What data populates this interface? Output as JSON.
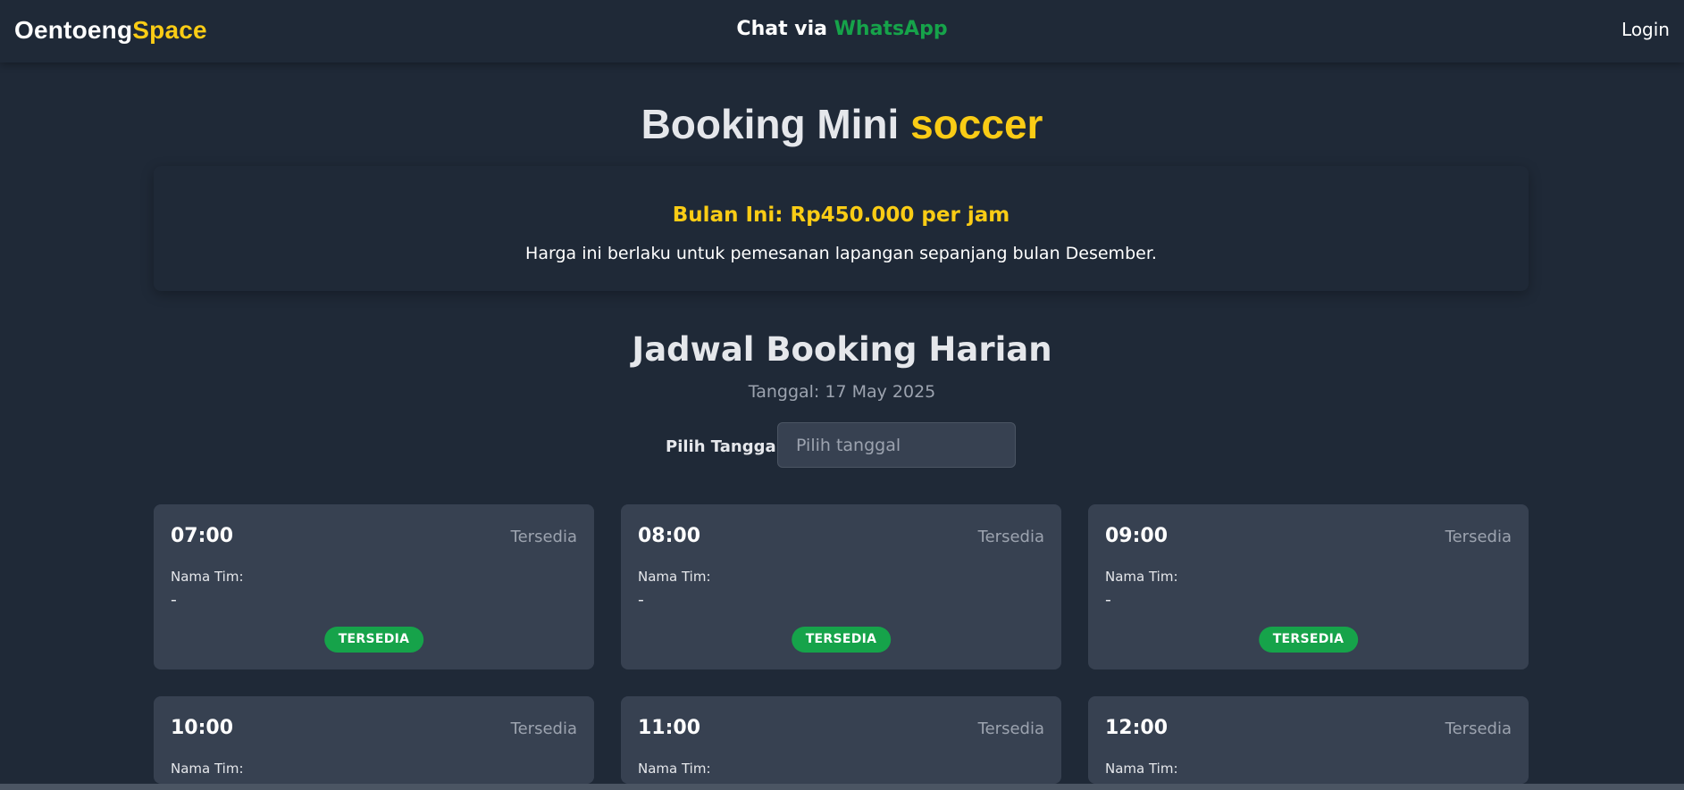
{
  "navbar": {
    "brand_part1": "Oentoeng",
    "brand_part2": "Space",
    "chat_prefix": "Chat via",
    "chat_link": "WhatsApp",
    "login": "Login"
  },
  "hero": {
    "title_prefix": "Booking Mini",
    "title_accent": "soccer"
  },
  "price": {
    "title": "Bulan Ini: Rp450.000 per jam",
    "description": "Harga ini berlaku untuk pemesanan lapangan sepanjang bulan Desember."
  },
  "schedule": {
    "title": "Jadwal Booking Harian",
    "date_text": "Tanggal: 17 May 2025",
    "picker_label": "Pilih Tanggal:",
    "picker_placeholder": "Pilih tanggal"
  },
  "slots": [
    {
      "time": "07:00",
      "status": "Tersedia",
      "team_label": "Nama Tim:",
      "team": "-",
      "badge": "TERSEDIA"
    },
    {
      "time": "08:00",
      "status": "Tersedia",
      "team_label": "Nama Tim:",
      "team": "-",
      "badge": "TERSEDIA"
    },
    {
      "time": "09:00",
      "status": "Tersedia",
      "team_label": "Nama Tim:",
      "team": "-",
      "badge": "TERSEDIA"
    },
    {
      "time": "10:00",
      "status": "Tersedia",
      "team_label": "Nama Tim:",
      "team": "",
      "badge": ""
    },
    {
      "time": "11:00",
      "status": "Tersedia",
      "team_label": "Nama Tim:",
      "team": "",
      "badge": ""
    },
    {
      "time": "12:00",
      "status": "Tersedia",
      "team_label": "Nama Tim:",
      "team": "",
      "badge": ""
    }
  ],
  "colors": {
    "background": "#1f2937",
    "card": "#374151",
    "accent_yellow": "#facc15",
    "accent_green": "#16a34a",
    "muted_text": "#9ca3af"
  }
}
